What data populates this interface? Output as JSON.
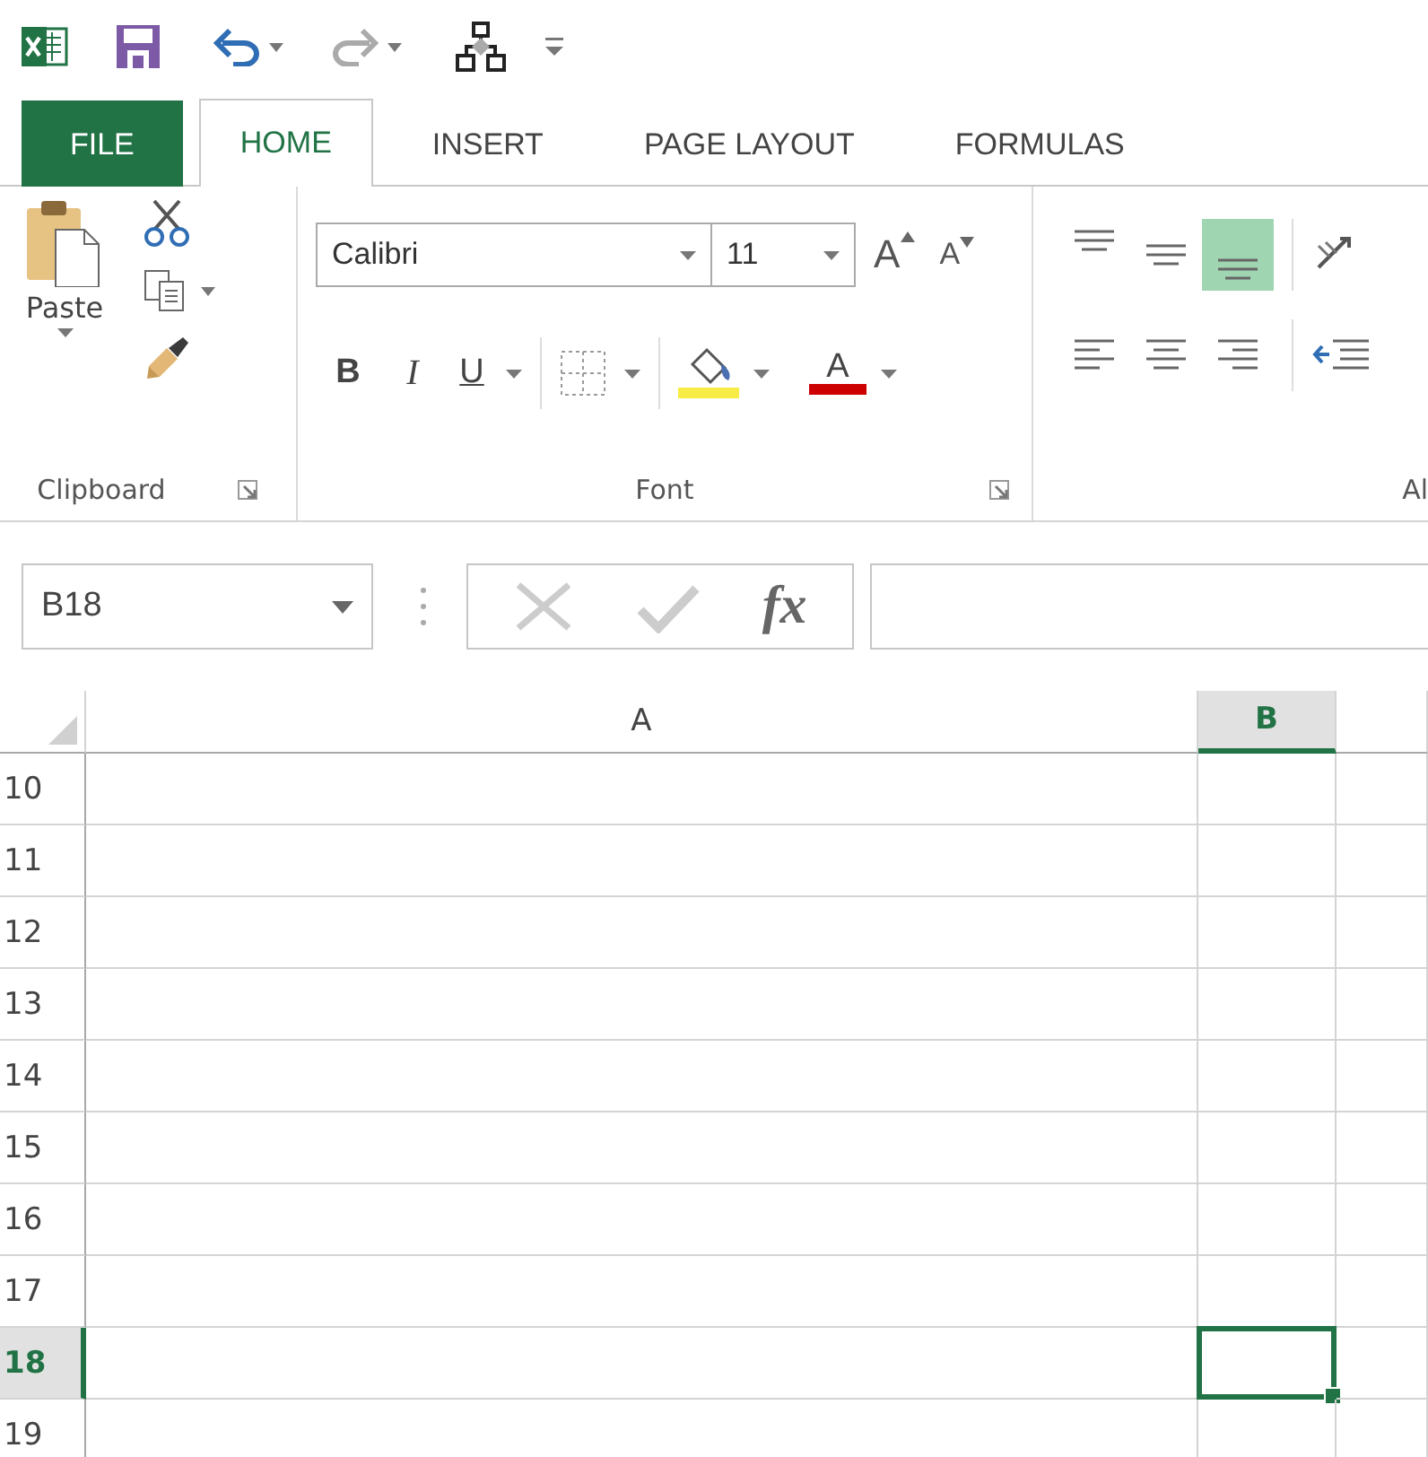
{
  "tabs": [
    {
      "label": "FILE",
      "kind": "file",
      "selected": false
    },
    {
      "label": "HOME",
      "kind": "tab",
      "selected": true
    },
    {
      "label": "INSERT",
      "kind": "tab",
      "selected": false
    },
    {
      "label": "PAGE LAYOUT",
      "kind": "tab",
      "selected": false
    },
    {
      "label": "FORMULAS",
      "kind": "tab",
      "selected": false
    }
  ],
  "ribbon": {
    "clipboard": {
      "paste_label": "Paste",
      "group_label": "Clipboard"
    },
    "font": {
      "font_name": "Calibri",
      "font_size": "11",
      "grow_label": "A",
      "shrink_label": "A",
      "bold": "B",
      "italic": "I",
      "underline": "U",
      "font_color_label": "A",
      "group_label": "Font"
    },
    "alignment": {
      "vertical_align_buttons": [
        {
          "selected": false
        },
        {
          "selected": false
        },
        {
          "selected": true
        }
      ],
      "group_label": "Al"
    }
  },
  "formula_bar": {
    "name_box": "B18",
    "function_label": "fx"
  },
  "sheet": {
    "columns": [
      {
        "label": "A",
        "selected": false
      },
      {
        "label": "B",
        "selected": true
      }
    ],
    "rows": [
      {
        "label": "10",
        "selected": false
      },
      {
        "label": "11",
        "selected": false
      },
      {
        "label": "12",
        "selected": false
      },
      {
        "label": "13",
        "selected": false
      },
      {
        "label": "14",
        "selected": false
      },
      {
        "label": "15",
        "selected": false
      },
      {
        "label": "16",
        "selected": false
      },
      {
        "label": "17",
        "selected": false
      },
      {
        "label": "18",
        "selected": true
      },
      {
        "label": "19",
        "selected": false
      }
    ]
  }
}
